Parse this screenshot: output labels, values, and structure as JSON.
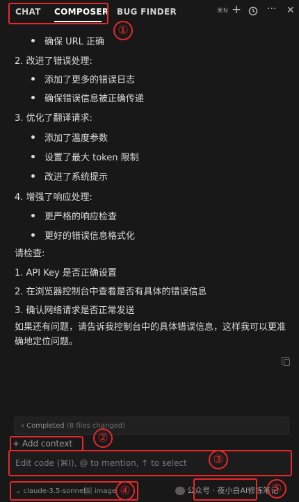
{
  "header": {
    "tabs": [
      {
        "label": "CHAT",
        "active": false
      },
      {
        "label": "COMPOSER",
        "active": true
      },
      {
        "label": "BUG FINDER",
        "active": false
      }
    ],
    "shortcut": "⌘N",
    "icons": [
      "plus-icon",
      "history-icon",
      "more-icon",
      "close-icon"
    ]
  },
  "content": {
    "lines": [
      {
        "type": "bullet",
        "text": "确保 URL 正确"
      },
      {
        "type": "numbered",
        "text": "2. 改进了错误处理:"
      },
      {
        "type": "bullet",
        "text": "添加了更多的错误日志"
      },
      {
        "type": "bullet",
        "text": "确保错误信息被正确传递"
      },
      {
        "type": "numbered",
        "text": "3. 优化了翻译请求:"
      },
      {
        "type": "bullet",
        "text": "添加了温度参数"
      },
      {
        "type": "bullet",
        "text": "设置了最大 token 限制"
      },
      {
        "type": "bullet",
        "text": "改进了系统提示"
      },
      {
        "type": "numbered",
        "text": "4. 增强了响应处理:"
      },
      {
        "type": "bullet",
        "text": "更严格的响应检查"
      },
      {
        "type": "bullet",
        "text": "更好的错误信息格式化"
      },
      {
        "type": "plain",
        "text": "请检查:"
      },
      {
        "type": "plain",
        "text": "1. API Key 是否正确设置"
      },
      {
        "type": "plain",
        "text": "2. 在浏览器控制台中查看是否有具体的错误信息"
      },
      {
        "type": "plain",
        "text": "3. 确认网络请求是否正常发送"
      }
    ],
    "closing_paragraph": "如果还有问题，请告诉我控制台中的具体错误信息，这样我可以更准确地定位问题。"
  },
  "composer": {
    "completed_label": "Completed",
    "completed_detail": "(8 files changed)",
    "add_context_label": "+ Add context",
    "input_placeholder": "Edit code (⌘I), @ to mention, ↑ to select",
    "model_label": "claude-3.5-sonnet",
    "image_label": "image",
    "watermark_text": "公众号 · 夜小白AI修炼笔记"
  },
  "annotations": [
    "①",
    "②",
    "③",
    "④",
    "⑤"
  ],
  "colors": {
    "background": "#181818",
    "annotation": "#e8282b",
    "text": "#dcdcdc"
  }
}
